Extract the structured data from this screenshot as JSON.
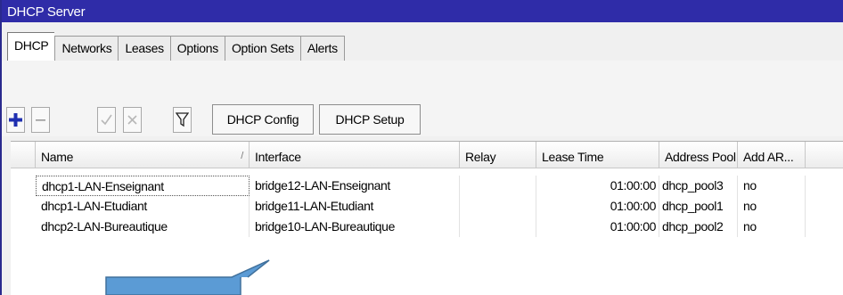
{
  "window": {
    "title": "DHCP Server"
  },
  "tabs": [
    {
      "label": "DHCP",
      "active": true
    },
    {
      "label": "Networks",
      "active": false
    },
    {
      "label": "Leases",
      "active": false
    },
    {
      "label": "Options",
      "active": false
    },
    {
      "label": "Option Sets",
      "active": false
    },
    {
      "label": "Alerts",
      "active": false
    }
  ],
  "toolbar": {
    "add_icon": "plus-icon",
    "remove_icon": "minus-icon",
    "enable_icon": "check-icon",
    "disable_icon": "cross-icon",
    "filter_icon": "filter-icon",
    "dhcp_config_label": "DHCP Config",
    "dhcp_setup_label": "DHCP Setup"
  },
  "table": {
    "columns": [
      "Name",
      "Interface",
      "Relay",
      "Lease Time",
      "Address Pool",
      "Add AR..."
    ],
    "sort_indicator": "/",
    "rows": [
      {
        "name": "dhcp1-LAN-Enseignant",
        "interface": "bridge12-LAN-Enseignant",
        "relay": "",
        "lease_time": "01:00:00",
        "address_pool": "dhcp_pool3",
        "add_arp": "no"
      },
      {
        "name": "dhcp1-LAN-Etudiant",
        "interface": "bridge11-LAN-Etudiant",
        "relay": "",
        "lease_time": "01:00:00",
        "address_pool": "dhcp_pool1",
        "add_arp": "no"
      },
      {
        "name": "dhcp2-LAN-Bureautique",
        "interface": "bridge10-LAN-Bureautique",
        "relay": "",
        "lease_time": "01:00:00",
        "address_pool": "dhcp_pool2",
        "add_arp": "no"
      }
    ]
  },
  "colors": {
    "titlebar": "#2f2ca8",
    "add_icon": "#1f2fb0",
    "callout_fill": "#5b9bd5"
  }
}
